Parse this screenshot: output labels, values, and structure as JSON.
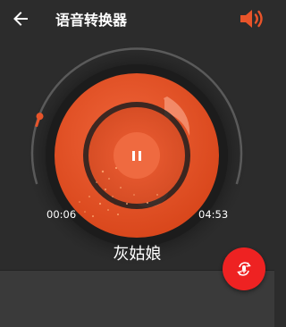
{
  "app": {
    "title": "语音转换器",
    "colors": {
      "background": "#2c2c2c",
      "accent": "#e8542a",
      "accent_dark": "#c5451e",
      "disc_dark": "#1f1f1f",
      "fab": "#ee2222"
    }
  },
  "toolbar": {
    "back_icon": "arrow-left-icon",
    "speaker_icon": "speaker-volume-icon"
  },
  "player": {
    "state": "playing",
    "pause_icon": "pause-icon",
    "progress_fraction": 0.02,
    "elapsed": "00:06",
    "total": "04:53",
    "song_title": "灰姑娘",
    "disc_icon": "music-note-icon"
  },
  "fab": {
    "icon": "voice-change-icon"
  }
}
